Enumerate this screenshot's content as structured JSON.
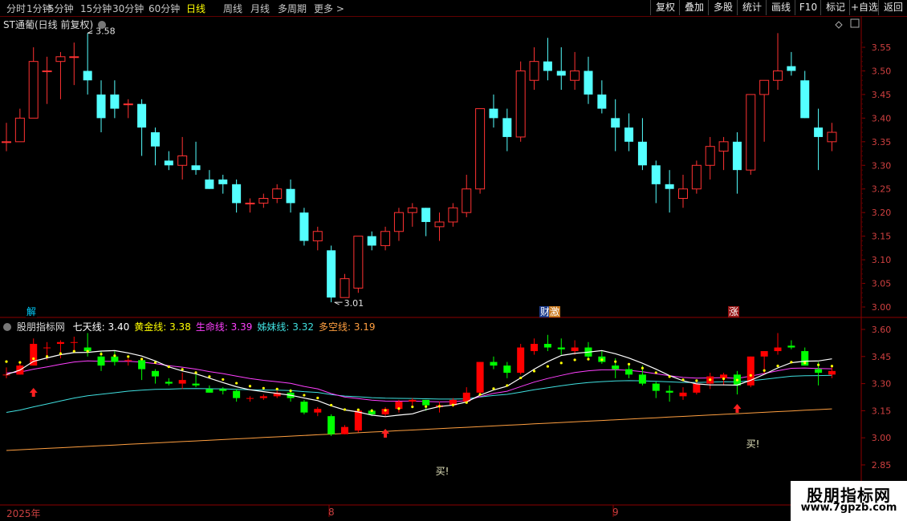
{
  "toolbar": {
    "left_items": [
      "分时",
      "1分钟",
      "5分钟",
      "15分钟",
      "30分钟",
      "60分钟",
      "日线",
      "周线",
      "月线",
      "多周期",
      "更多 >"
    ],
    "active": "日线",
    "right_items": [
      "复权",
      "叠加",
      "多股",
      "统计",
      "画线",
      "F10",
      "标记",
      "+自选",
      "返回"
    ]
  },
  "main_chart": {
    "title": "ST通葡(日线 前复权)",
    "high_label": "3.58",
    "low_label": "3.01",
    "axis_ticks": [
      "3.55",
      "3.50",
      "3.45",
      "3.40",
      "3.35",
      "3.30",
      "3.25",
      "3.20",
      "3.15",
      "3.10",
      "3.05",
      "3.00"
    ],
    "badges": [
      {
        "text": "解",
        "bg": "#000000",
        "color": "#00d0ff"
      },
      {
        "text": "财",
        "bg": "#1e3c8c",
        "color": "#ffffff"
      },
      {
        "text": "激",
        "bg": "#c8781e",
        "color": "#ffffff"
      },
      {
        "text": "涨",
        "bg": "#961414",
        "color": "#ffffff"
      }
    ]
  },
  "indicator": {
    "name": "股朋指标网",
    "lines": [
      {
        "label": "七天线: 3.40",
        "color": "#ffffff"
      },
      {
        "label": "黄金线: 3.38",
        "color": "#ffff00"
      },
      {
        "label": "生命线: 3.39",
        "color": "#ff40ff"
      },
      {
        "label": "姊妹线: 3.32",
        "color": "#40e0e0"
      },
      {
        "label": "多空线: 3.19",
        "color": "#ff9f40"
      }
    ],
    "axis_ticks": [
      "3.60",
      "3.45",
      "3.30",
      "3.15",
      "3.00",
      "2.85"
    ],
    "buy_labels": [
      "买!",
      "买!"
    ]
  },
  "date_labels": [
    "2025年",
    "8",
    "9"
  ],
  "watermark": {
    "title": "股朋指标网",
    "url": "www.7gpzb.com"
  },
  "colors": {
    "up": "#ff3232",
    "down": "#54ffff",
    "ind_up": "#ff0000",
    "ind_down": "#00ff00",
    "grid": "#8b0000"
  },
  "chart_data": {
    "type": "candlestick",
    "ohlc": [
      [
        3.35,
        3.39,
        3.33,
        3.35
      ],
      [
        3.35,
        3.42,
        3.35,
        3.4
      ],
      [
        3.4,
        3.55,
        3.4,
        3.52
      ],
      [
        3.5,
        3.53,
        3.43,
        3.5
      ],
      [
        3.52,
        3.54,
        3.44,
        3.53
      ],
      [
        3.53,
        3.56,
        3.47,
        3.53
      ],
      [
        3.5,
        3.58,
        3.45,
        3.48
      ],
      [
        3.45,
        3.48,
        3.37,
        3.4
      ],
      [
        3.45,
        3.48,
        3.4,
        3.42
      ],
      [
        3.43,
        3.44,
        3.4,
        3.43
      ],
      [
        3.43,
        3.44,
        3.32,
        3.38
      ],
      [
        3.37,
        3.38,
        3.3,
        3.34
      ],
      [
        3.31,
        3.33,
        3.29,
        3.3
      ],
      [
        3.3,
        3.36,
        3.27,
        3.32
      ],
      [
        3.3,
        3.35,
        3.28,
        3.29
      ],
      [
        3.27,
        3.29,
        3.25,
        3.25
      ],
      [
        3.27,
        3.28,
        3.24,
        3.26
      ],
      [
        3.26,
        3.27,
        3.2,
        3.22
      ],
      [
        3.22,
        3.23,
        3.2,
        3.22
      ],
      [
        3.22,
        3.24,
        3.21,
        3.23
      ],
      [
        3.23,
        3.26,
        3.22,
        3.25
      ],
      [
        3.25,
        3.27,
        3.2,
        3.22
      ],
      [
        3.2,
        3.21,
        3.13,
        3.14
      ],
      [
        3.14,
        3.17,
        3.12,
        3.16
      ],
      [
        3.12,
        3.13,
        3.01,
        3.02
      ],
      [
        3.02,
        3.07,
        3.02,
        3.06
      ],
      [
        3.04,
        3.15,
        3.03,
        3.15
      ],
      [
        3.15,
        3.16,
        3.12,
        3.13
      ],
      [
        3.13,
        3.17,
        3.12,
        3.16
      ],
      [
        3.16,
        3.21,
        3.14,
        3.2
      ],
      [
        3.2,
        3.22,
        3.17,
        3.21
      ],
      [
        3.21,
        3.21,
        3.15,
        3.18
      ],
      [
        3.17,
        3.2,
        3.14,
        3.18
      ],
      [
        3.18,
        3.22,
        3.17,
        3.21
      ],
      [
        3.2,
        3.28,
        3.19,
        3.25
      ],
      [
        3.25,
        3.42,
        3.24,
        3.42
      ],
      [
        3.42,
        3.45,
        3.38,
        3.4
      ],
      [
        3.4,
        3.42,
        3.33,
        3.36
      ],
      [
        3.36,
        3.52,
        3.35,
        3.5
      ],
      [
        3.48,
        3.55,
        3.46,
        3.52
      ],
      [
        3.52,
        3.57,
        3.48,
        3.5
      ],
      [
        3.5,
        3.55,
        3.46,
        3.49
      ],
      [
        3.48,
        3.54,
        3.46,
        3.5
      ],
      [
        3.5,
        3.53,
        3.43,
        3.45
      ],
      [
        3.45,
        3.48,
        3.41,
        3.42
      ],
      [
        3.4,
        3.44,
        3.33,
        3.38
      ],
      [
        3.38,
        3.41,
        3.33,
        3.35
      ],
      [
        3.35,
        3.4,
        3.29,
        3.3
      ],
      [
        3.3,
        3.31,
        3.22,
        3.26
      ],
      [
        3.26,
        3.29,
        3.2,
        3.25
      ],
      [
        3.23,
        3.28,
        3.21,
        3.25
      ],
      [
        3.25,
        3.31,
        3.24,
        3.3
      ],
      [
        3.3,
        3.36,
        3.27,
        3.34
      ],
      [
        3.33,
        3.36,
        3.29,
        3.35
      ],
      [
        3.35,
        3.37,
        3.24,
        3.29
      ],
      [
        3.29,
        3.45,
        3.28,
        3.45
      ],
      [
        3.45,
        3.48,
        3.35,
        3.48
      ],
      [
        3.48,
        3.58,
        3.46,
        3.5
      ],
      [
        3.51,
        3.54,
        3.49,
        3.5
      ],
      [
        3.48,
        3.5,
        3.4,
        3.4
      ],
      [
        3.38,
        3.42,
        3.29,
        3.36
      ],
      [
        3.35,
        3.39,
        3.33,
        3.37
      ]
    ]
  }
}
